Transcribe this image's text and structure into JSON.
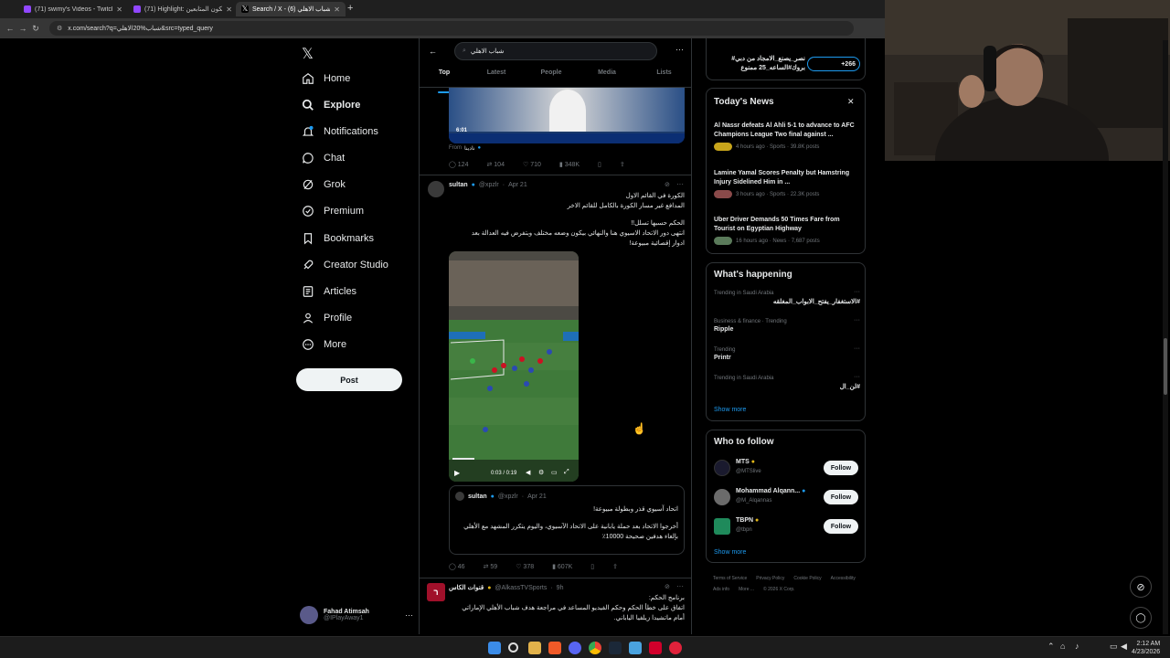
{
  "browser": {
    "tabs": [
      {
        "title": "(71) swimy's Videos - Twitch",
        "active": false
      },
      {
        "title": "(71) Highlight: رايكون المتابعين",
        "active": false
      },
      {
        "title": "Search / X - شباب الاهلي (6)",
        "active": true
      }
    ],
    "url": "x.com/search?q=شباب%20الاهلي&src=typed_query"
  },
  "sidebar": {
    "items": [
      {
        "label": "Home",
        "icon": "home-icon"
      },
      {
        "label": "Explore",
        "icon": "search-icon"
      },
      {
        "label": "Notifications",
        "icon": "bell-icon"
      },
      {
        "label": "Chat",
        "icon": "chat-icon"
      },
      {
        "label": "Grok",
        "icon": "grok-icon"
      },
      {
        "label": "Premium",
        "icon": "x-logo-icon"
      },
      {
        "label": "Bookmarks",
        "icon": "bookmark-icon"
      },
      {
        "label": "Creator Studio",
        "icon": "rocket-icon"
      },
      {
        "label": "Articles",
        "icon": "article-icon"
      },
      {
        "label": "Profile",
        "icon": "person-icon"
      },
      {
        "label": "More",
        "icon": "more-circle-icon"
      }
    ],
    "post_label": "Post",
    "account": {
      "name": "Fahad Atimsah",
      "handle": "@IPlayAway1"
    }
  },
  "search": {
    "query": "شباب الاهلي",
    "tabs": [
      "Top",
      "Latest",
      "People",
      "Media",
      "Lists"
    ]
  },
  "tweets": [
    {
      "from_label": "From",
      "from_name": "نادينا",
      "video_time": "6:01",
      "stats": {
        "replies": "124",
        "reposts": "104",
        "likes": "710",
        "views": "348K"
      }
    },
    {
      "name": "sultan",
      "handle": "@xpzlr",
      "date": "Apr 21",
      "lines": [
        "الكورة في القائم الاول",
        "المدافع غير مسار الكورة بالكامل للقائم الاخر",
        "",
        "الحكم حسبها تسلل!!",
        "انتهى دور الاتحاد الاسيوي هنا والنهائي بيكون وضعه مختلف وبتفرض فيه العدالة بعد",
        "ادوار إقصائية مبيوعة!"
      ],
      "video_controls": "0:03 / 0:19",
      "quote": {
        "name": "sultan",
        "handle": "@xpzlr",
        "date": "Apr 21",
        "lines": [
          "اتحاد آسيوي قذر وبطولة مبيوعة!",
          "",
          "أخرجوا الاتحاد بعد حملة يابانية على الاتحاد الآسيوي، واليوم يتكرر المشهد مع الأهلي",
          "بإلغاء هدفين صحيحة 10000٪"
        ]
      },
      "stats": {
        "replies": "46",
        "reposts": "59",
        "likes": "378",
        "views": "607K"
      }
    },
    {
      "name": "قنوات الكاس",
      "handle": "@AlkassTVSports",
      "date": "9h",
      "lines": [
        "برنامج الحكم:",
        "اتفاق على خطأ الحكم وحكم الفيديو المساعد في مراجعة هدف شباب الأهلي الإماراتي",
        "أمام ماتشيدا زيلفيا الياباني."
      ]
    }
  ],
  "right": {
    "top_item": {
      "title": "نصر_يصنع_الامجاد من دبي#",
      "subtitle": "بروك#الساعه_25 ممنوع",
      "count": "+266"
    },
    "news": {
      "title": "Today's News",
      "items": [
        {
          "headline": "Al Nassr defeats Al Ahli 5-1 to advance to AFC Champions League Two final against ...",
          "meta": "4 hours ago · Sports · 39.8K posts"
        },
        {
          "headline": "Lamine Yamal Scores Penalty but Hamstring Injury Sidelined Him in ...",
          "meta": "3 hours ago · Sports · 22.3K posts"
        },
        {
          "headline": "Uber Driver Demands 50 Times Fare from Tourist on Egyptian Highway",
          "meta": "16 hours ago · News · 7,687 posts"
        }
      ]
    },
    "happening": {
      "title": "What's happening",
      "items": [
        {
          "context": "Trending in Saudi Arabia",
          "topic": "#الاستغفار_يفتح_الابواب_المغلقه"
        },
        {
          "context": "Business & finance · Trending",
          "topic": "Ripple"
        },
        {
          "context": "Trending",
          "topic": "Printr"
        },
        {
          "context": "Trending in Saudi Arabia",
          "topic": "#لن_ال"
        }
      ],
      "show_more": "Show more"
    },
    "follow": {
      "title": "Who to follow",
      "items": [
        {
          "name": "MTS",
          "handle": "@MTSlive"
        },
        {
          "name": "Mohammad Alqann...",
          "handle": "@M_Alqannas"
        },
        {
          "name": "TBPN",
          "handle": "@tbpn"
        }
      ],
      "button": "Follow",
      "show_more": "Show more"
    },
    "footer": [
      "Terms of Service",
      "Privacy Policy",
      "Cookie Policy",
      "Accessibility",
      "Ads info",
      "More ...",
      "© 2026 X Corp."
    ]
  },
  "taskbar": {
    "time": "2:12 AM",
    "date": "4/23/2026"
  },
  "colors": {
    "accent": "#1d9bf0",
    "background": "#000000",
    "border": "#2f3336",
    "muted": "#71767b",
    "verified_gold": "#e2b719"
  }
}
